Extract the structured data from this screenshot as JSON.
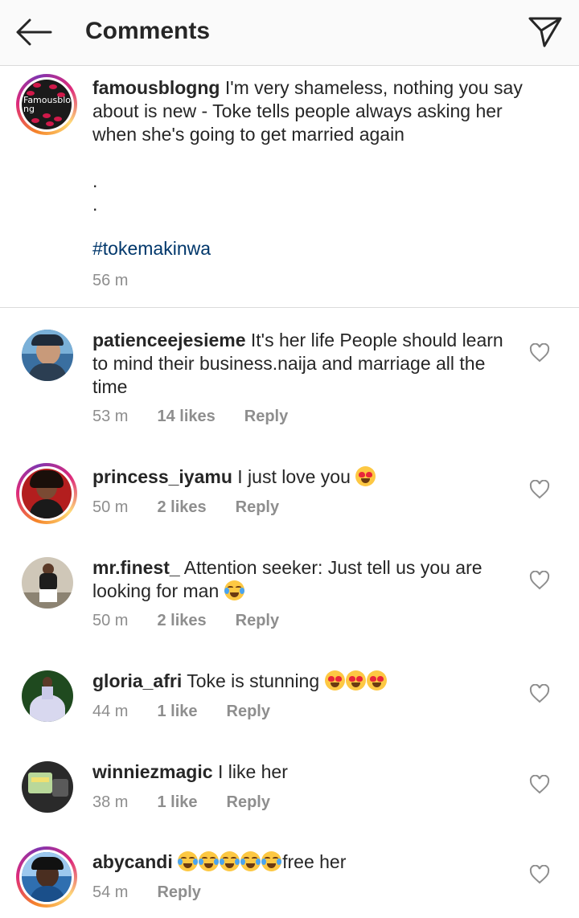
{
  "header": {
    "title": "Comments"
  },
  "caption": {
    "avatar_text": "Famousblog ng",
    "username": "famousblogng",
    "text": "I'm very shameless, nothing you say about is new - Toke tells people always asking her when she's going to get married again",
    "dot1": ".",
    "dot2": ".",
    "hashtag": "#tokemakinwa",
    "time": "56 m"
  },
  "comments": [
    {
      "username": "patienceejesieme",
      "text": "It's her life People should learn to mind their business.naija and marriage all the time",
      "time": "53 m",
      "likes": "14 likes",
      "reply": "Reply"
    },
    {
      "username": "princess_iyamu",
      "text": "I just love you",
      "emoji": "heart-eyes-emoji",
      "time": "50 m",
      "likes": "2 likes",
      "reply": "Reply"
    },
    {
      "username": "mr.finest_",
      "text": "Attention seeker: Just tell us you are looking for man",
      "emoji": "tears-of-joy-emoji",
      "time": "50 m",
      "likes": "2 likes",
      "reply": "Reply"
    },
    {
      "username": "gloria_afri",
      "text": "Toke is stunning",
      "emoji": "heart-eyes-emoji x3",
      "time": "44 m",
      "likes": "1 like",
      "reply": "Reply"
    },
    {
      "username": "winniezmagic",
      "text": "I like her",
      "time": "38 m",
      "likes": "1 like",
      "reply": "Reply"
    },
    {
      "username": "abycandi",
      "text": "free her",
      "emoji": "tears-of-joy-emoji x5",
      "time": "54 m",
      "likes": "",
      "reply": "Reply"
    }
  ],
  "icons": {
    "back": "back-arrow-icon",
    "send": "direct-send-icon",
    "like": "heart-outline-icon"
  }
}
